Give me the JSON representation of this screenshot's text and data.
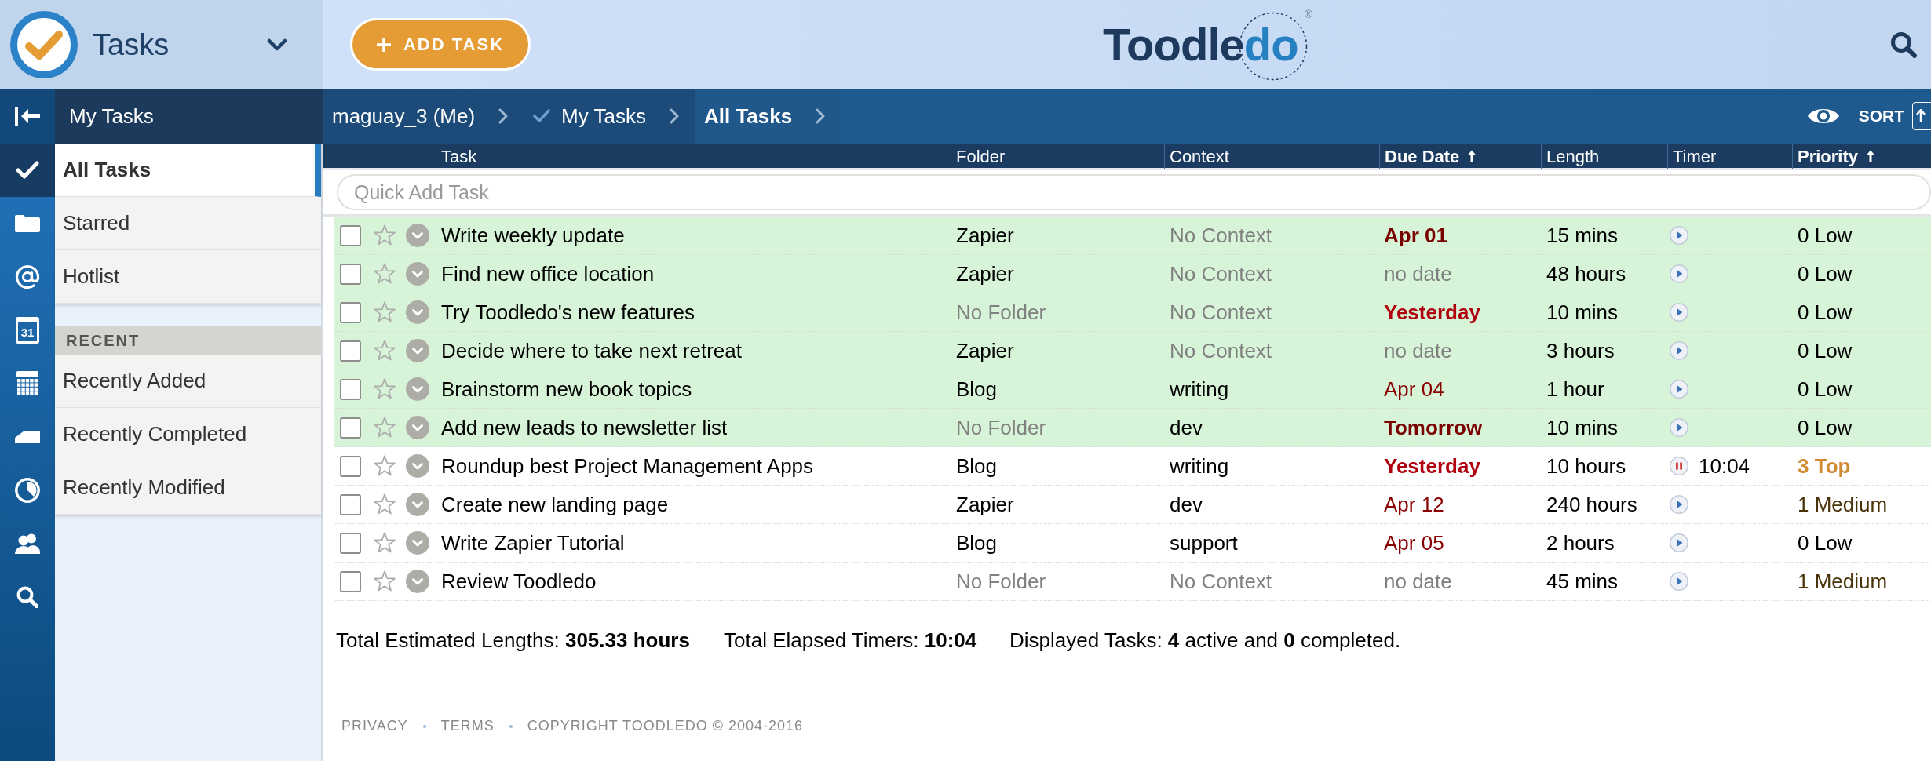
{
  "header": {
    "section_title": "Tasks",
    "add_button": "ADD TASK",
    "logo": {
      "text": "Toodle",
      "accent": "do",
      "mark": "®"
    }
  },
  "sidebar": {
    "title": "My Tasks",
    "rail": [
      {
        "kind": "tasks",
        "selected": true
      },
      {
        "kind": "folders",
        "selected": false
      },
      {
        "kind": "contexts",
        "selected": false
      },
      {
        "kind": "day",
        "text": "31",
        "selected": false
      },
      {
        "kind": "month",
        "selected": false
      },
      {
        "kind": "label",
        "selected": false
      },
      {
        "kind": "chart",
        "selected": false
      },
      {
        "kind": "people",
        "selected": false
      },
      {
        "kind": "search",
        "selected": false
      }
    ],
    "items": [
      {
        "label": "All Tasks",
        "selected": true
      },
      {
        "label": "Starred",
        "selected": false
      },
      {
        "label": "Hotlist",
        "selected": false
      }
    ],
    "recent": {
      "heading": "RECENT",
      "items": [
        {
          "label": "Recently Added",
          "selected": false
        },
        {
          "label": "Recently Completed",
          "selected": false
        },
        {
          "label": "Recently Modified",
          "selected": false
        }
      ]
    }
  },
  "breadcrumb": [
    {
      "label": "maguay_3 (Me)",
      "kind": "plain",
      "selected": false
    },
    {
      "label": "My Tasks",
      "kind": "check",
      "selected": false
    },
    {
      "label": "All Tasks",
      "kind": "plain",
      "selected": true
    }
  ],
  "toolbar": {
    "sort_label": "SORT"
  },
  "table": {
    "columns": [
      {
        "label": "Task",
        "sorted": false
      },
      {
        "label": "Folder",
        "sorted": false
      },
      {
        "label": "Context",
        "sorted": false
      },
      {
        "label": "Due Date",
        "sorted": true
      },
      {
        "label": "Length",
        "sorted": false
      },
      {
        "label": "Timer",
        "sorted": false
      },
      {
        "label": "Priority",
        "sorted": true
      }
    ],
    "quick_add": {
      "placeholder": "Quick Add Task"
    },
    "rows": [
      {
        "highlighted": true,
        "checked": false,
        "starred": false,
        "task": "Write weekly update",
        "folder": {
          "text": "Zapier",
          "muted": false
        },
        "context": {
          "text": "No Context",
          "muted": true
        },
        "due": {
          "text": "Apr 01",
          "kind": "near"
        },
        "length": "15 mins",
        "timer": {
          "running": false
        },
        "priority": {
          "text": "0 Low",
          "kind": "low"
        }
      },
      {
        "highlighted": true,
        "checked": false,
        "starred": false,
        "task": "Find new office location",
        "folder": {
          "text": "Zapier",
          "muted": false
        },
        "context": {
          "text": "No Context",
          "muted": true
        },
        "due": {
          "text": "no date",
          "kind": "none"
        },
        "length": "48 hours",
        "timer": {
          "running": false
        },
        "priority": {
          "text": "0 Low",
          "kind": "low"
        }
      },
      {
        "highlighted": true,
        "checked": false,
        "starred": false,
        "task": "Try Toodledo's new features",
        "folder": {
          "text": "No Folder",
          "muted": true
        },
        "context": {
          "text": "No Context",
          "muted": true
        },
        "due": {
          "text": "Yesterday",
          "kind": "overdue"
        },
        "length": "10 mins",
        "timer": {
          "running": false
        },
        "priority": {
          "text": "0 Low",
          "kind": "low"
        }
      },
      {
        "highlighted": true,
        "checked": false,
        "starred": false,
        "task": "Decide where to take next retreat",
        "folder": {
          "text": "Zapier",
          "muted": false
        },
        "context": {
          "text": "No Context",
          "muted": true
        },
        "due": {
          "text": "no date",
          "kind": "none"
        },
        "length": "3 hours",
        "timer": {
          "running": false
        },
        "priority": {
          "text": "0 Low",
          "kind": "low"
        }
      },
      {
        "highlighted": true,
        "checked": false,
        "starred": false,
        "task": "Brainstorm new book topics",
        "folder": {
          "text": "Blog",
          "muted": false
        },
        "context": {
          "text": "writing",
          "muted": false
        },
        "due": {
          "text": "Apr 04",
          "kind": "later"
        },
        "length": "1 hour",
        "timer": {
          "running": false
        },
        "priority": {
          "text": "0 Low",
          "kind": "low"
        }
      },
      {
        "highlighted": true,
        "checked": false,
        "starred": false,
        "task": "Add new leads to newsletter list",
        "folder": {
          "text": "No Folder",
          "muted": true
        },
        "context": {
          "text": "dev",
          "muted": false
        },
        "due": {
          "text": "Tomorrow",
          "kind": "near"
        },
        "length": "10 mins",
        "timer": {
          "running": false
        },
        "priority": {
          "text": "0 Low",
          "kind": "low"
        }
      },
      {
        "highlighted": false,
        "checked": false,
        "starred": false,
        "task": "Roundup best Project Management Apps",
        "folder": {
          "text": "Blog",
          "muted": false
        },
        "context": {
          "text": "writing",
          "muted": false
        },
        "due": {
          "text": "Yesterday",
          "kind": "overdue"
        },
        "length": "10 hours",
        "timer": {
          "running": true,
          "elapsed": "10:04"
        },
        "priority": {
          "text": "3 Top",
          "kind": "top"
        }
      },
      {
        "highlighted": false,
        "checked": false,
        "starred": false,
        "task": "Create new landing page",
        "folder": {
          "text": "Zapier",
          "muted": false
        },
        "context": {
          "text": "dev",
          "muted": false
        },
        "due": {
          "text": "Apr 12",
          "kind": "later"
        },
        "length": "240 hours",
        "timer": {
          "running": false
        },
        "priority": {
          "text": "1 Medium",
          "kind": "medium"
        }
      },
      {
        "highlighted": false,
        "checked": false,
        "starred": false,
        "task": "Write Zapier Tutorial",
        "folder": {
          "text": "Blog",
          "muted": false
        },
        "context": {
          "text": "support",
          "muted": false
        },
        "due": {
          "text": "Apr 05",
          "kind": "later"
        },
        "length": "2 hours",
        "timer": {
          "running": false
        },
        "priority": {
          "text": "0 Low",
          "kind": "low"
        }
      },
      {
        "highlighted": false,
        "checked": false,
        "starred": false,
        "task": "Review Toodledo",
        "folder": {
          "text": "No Folder",
          "muted": true
        },
        "context": {
          "text": "No Context",
          "muted": true
        },
        "due": {
          "text": "no date",
          "kind": "none"
        },
        "length": "45 mins",
        "timer": {
          "running": false
        },
        "priority": {
          "text": "1 Medium",
          "kind": "medium"
        }
      }
    ]
  },
  "summary": [
    "Total Estimated Lengths: **305.33 hours**",
    "Total Elapsed Timers: **10:04**",
    "Displayed Tasks: **4** active and **0** completed."
  ],
  "footer": {
    "links": [
      "PRIVACY",
      "TERMS"
    ],
    "copyright": "COPYRIGHT TOODLEDO © 2004-2016"
  }
}
